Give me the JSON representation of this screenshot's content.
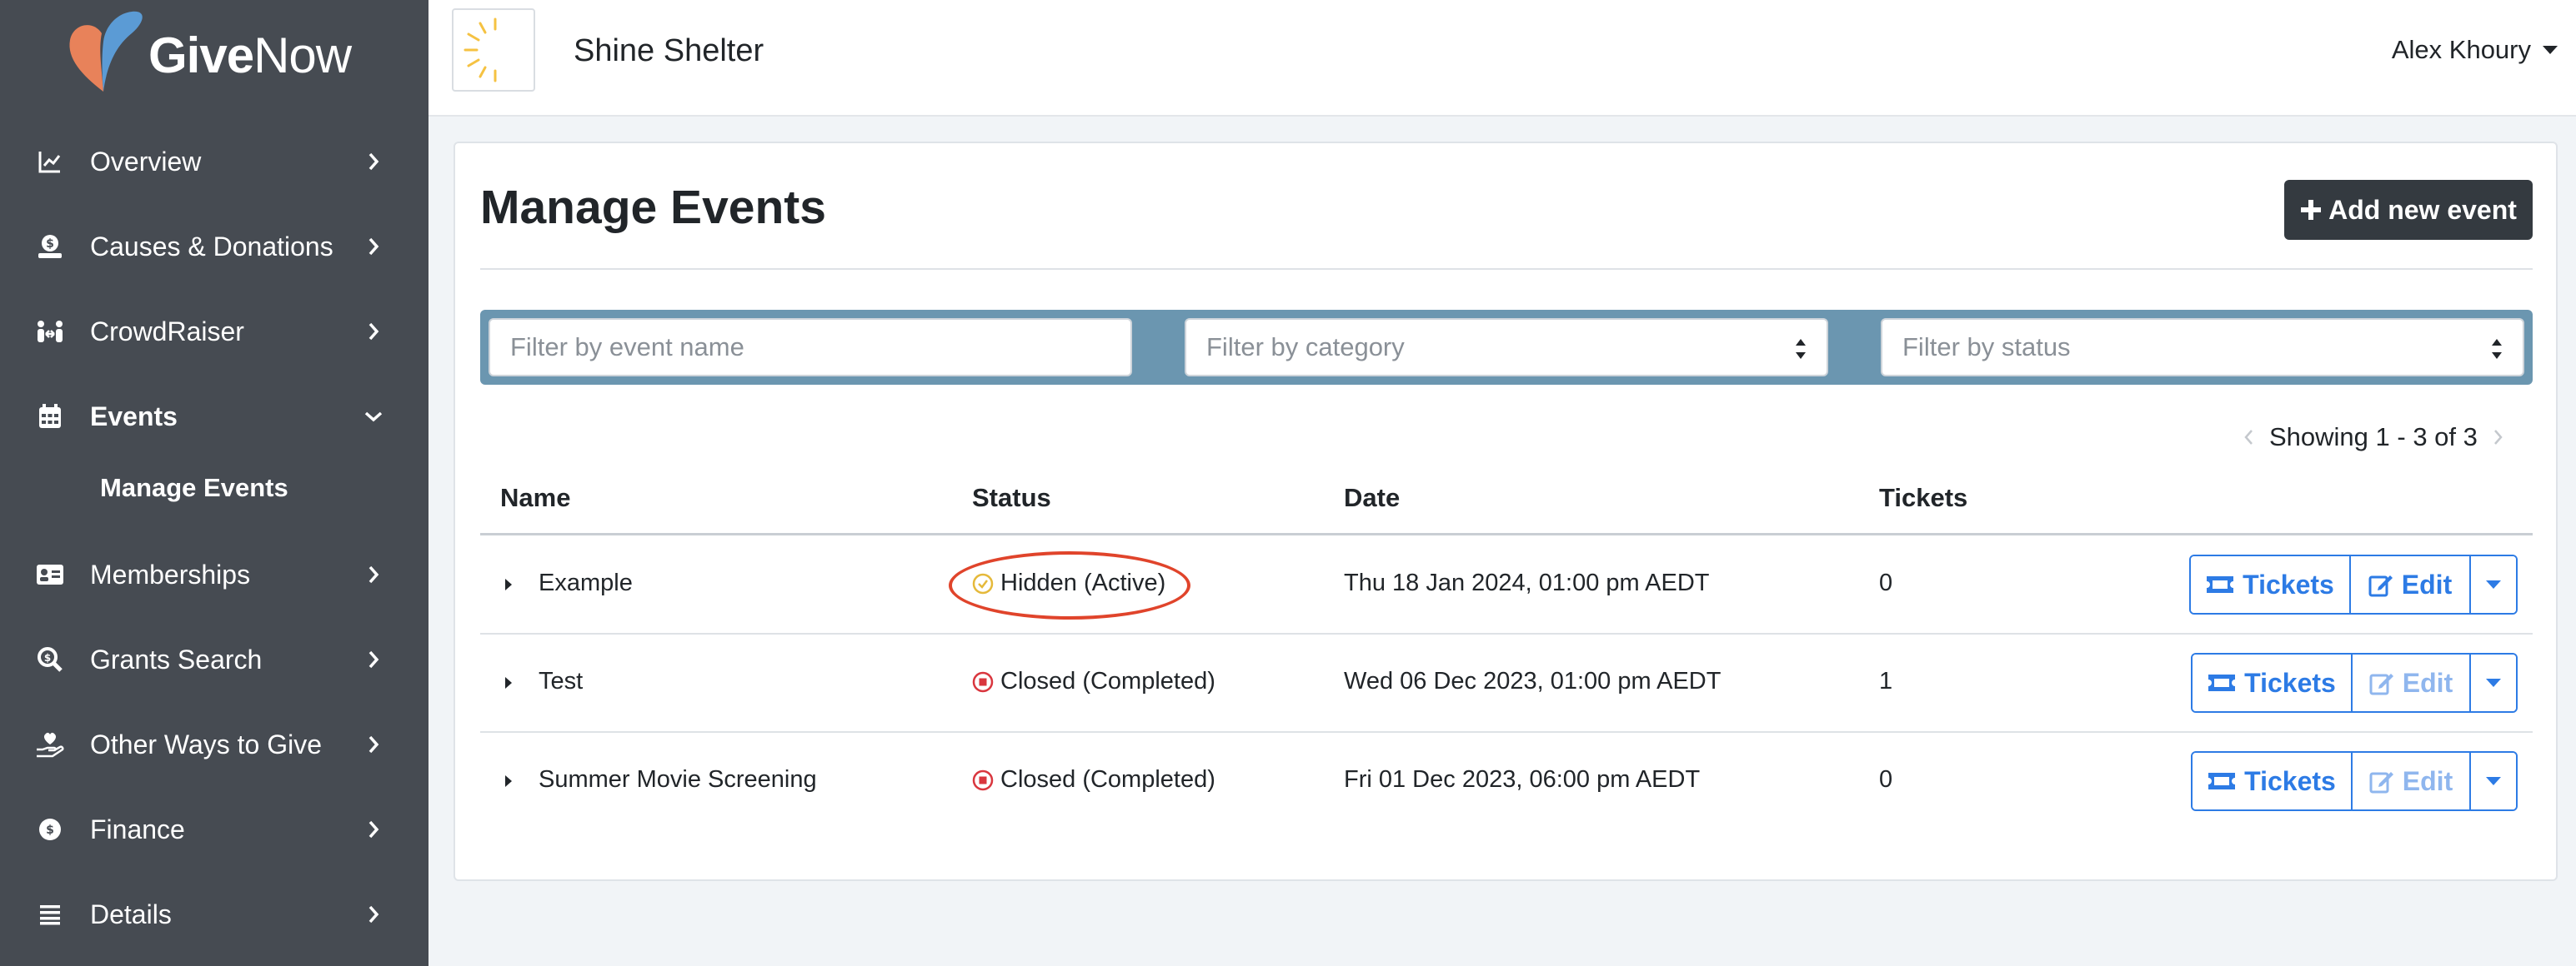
{
  "brand": {
    "name_bold": "Give",
    "name_light": "Now"
  },
  "sidebar": {
    "items": [
      {
        "label": "Overview",
        "icon": "chart-line-icon"
      },
      {
        "label": "Causes & Donations",
        "icon": "donation-icon"
      },
      {
        "label": "CrowdRaiser",
        "icon": "people-arrows-icon"
      },
      {
        "label": "Events",
        "icon": "calendar-icon",
        "expanded": true
      },
      {
        "label": "Memberships",
        "icon": "id-card-icon"
      },
      {
        "label": "Grants Search",
        "icon": "search-dollar-icon"
      },
      {
        "label": "Other Ways to Give",
        "icon": "hand-holding-heart-icon"
      },
      {
        "label": "Finance",
        "icon": "coins-icon"
      },
      {
        "label": "Details",
        "icon": "list-icon"
      }
    ],
    "sub_item": "Manage Events"
  },
  "header": {
    "org_name": "Shine Shelter",
    "user_name": "Alex Khoury"
  },
  "main": {
    "title": "Manage Events",
    "add_button": "Add new event",
    "filters": {
      "name_placeholder": "Filter by event name",
      "category_placeholder": "Filter by category",
      "status_placeholder": "Filter by status"
    },
    "pagination": "Showing 1 - 3 of 3",
    "columns": [
      "Name",
      "Status",
      "Date",
      "Tickets"
    ],
    "rows": [
      {
        "name": "Example",
        "status": "Hidden (Active)",
        "status_kind": "active",
        "date": "Thu 18 Jan 2024, 01:00 pm AEDT",
        "tickets": "0",
        "edit_enabled": true,
        "highlighted": true
      },
      {
        "name": "Test",
        "status": "Closed (Completed)",
        "status_kind": "closed",
        "date": "Wed 06 Dec 2023, 01:00 pm AEDT",
        "tickets": "1",
        "edit_enabled": false,
        "highlighted": false
      },
      {
        "name": "Summer Movie Screening",
        "status": "Closed (Completed)",
        "status_kind": "closed",
        "date": "Fri 01 Dec 2023, 06:00 pm AEDT",
        "tickets": "0",
        "edit_enabled": false,
        "highlighted": false
      }
    ],
    "tickets_button": "Tickets",
    "edit_button": "Edit"
  },
  "colors": {
    "sidebar_bg": "#464b52",
    "primary": "#2d7be5",
    "filter_bar": "#6b96b0",
    "annotation_red": "#e0442b",
    "active_status": "#e5b93a",
    "closed_status": "#d9363e"
  }
}
